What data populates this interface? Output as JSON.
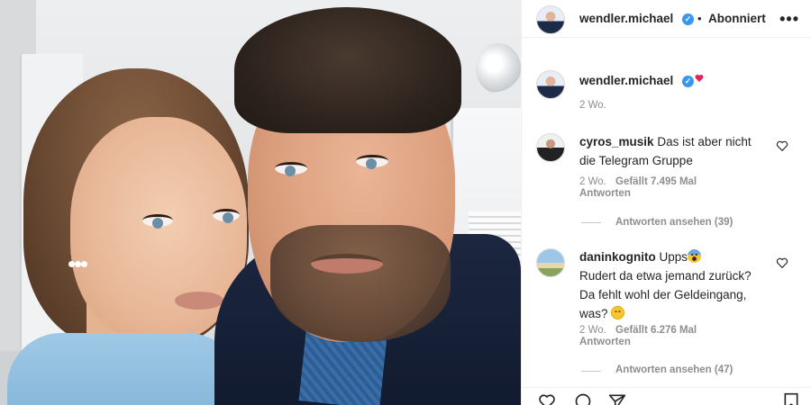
{
  "header": {
    "username": "wendler.michael",
    "separator": "•",
    "follow_label": "Abonniert",
    "more_label": "•••"
  },
  "caption": {
    "username": "wendler.michael",
    "time": "2 Wo."
  },
  "comments": [
    {
      "username": "cyros_musik",
      "text_line1": "Das ist aber nicht",
      "text_line2": "die Telegram Gruppe",
      "time": "2 Wo.",
      "likes": "Gefällt 7.495 Mal",
      "reply_label": "Antworten",
      "view_replies": "Antworten ansehen (39)"
    },
    {
      "username": "daninkognito",
      "text_line1": "Upps",
      "text_line2": "Rudert da etwa jemand zurück?",
      "text_line3": "Da fehlt wohl der Geldeingang,",
      "text_line4": "was?",
      "time": "2 Wo.",
      "likes": "Gefällt 6.276 Mal",
      "reply_label": "Antworten",
      "view_replies": "Antworten ansehen (47)"
    }
  ],
  "icons": [
    "verified-badge-icon",
    "more-options-icon",
    "like-heart-icon",
    "comment-icon",
    "share-icon",
    "save-bookmark-icon",
    "scream-emoji-icon",
    "smile-emoji-icon",
    "heart-emoji-icon"
  ],
  "colors": {
    "verified": "#3897f0",
    "muted": "#8e8e8e",
    "text": "#262626"
  }
}
